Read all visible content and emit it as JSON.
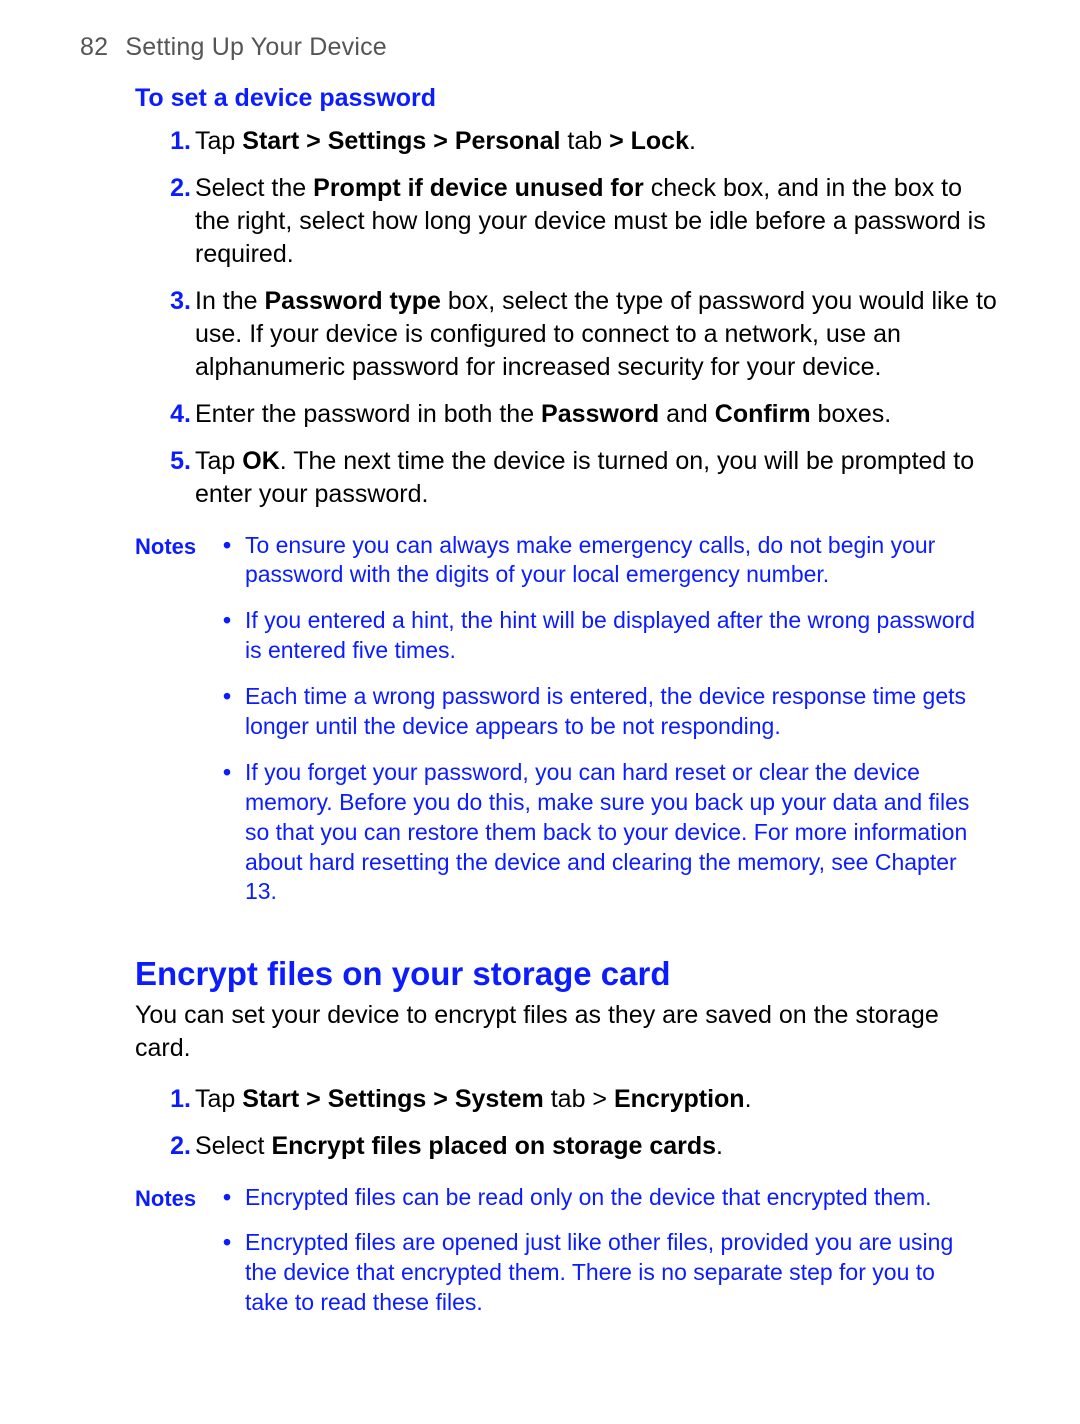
{
  "header": {
    "page_number": "82",
    "title": "Setting Up Your Device"
  },
  "section1": {
    "subheading": "To set a device password",
    "steps": [
      {
        "n": "1.",
        "pre": "Tap ",
        "b1": "Start > Settings > Personal",
        "mid": " tab ",
        "b2": "> Lock",
        "post": "."
      },
      {
        "n": "2.",
        "pre": "Select the ",
        "b1": "Prompt if device unused for",
        "mid": " check box, and in the box to the right, select how long your device must be idle before a password is required.",
        "b2": "",
        "post": ""
      },
      {
        "n": "3.",
        "pre": "In the ",
        "b1": "Password type",
        "mid": " box, select the type of password you would like to use. If your device is configured to connect to a network, use an alphanumeric password for increased security for your device.",
        "b2": "",
        "post": ""
      },
      {
        "n": "4.",
        "pre": "Enter the password in both the ",
        "b1": "Password",
        "mid": " and ",
        "b2": "Confirm",
        "post": " boxes."
      },
      {
        "n": "5.",
        "pre": "Tap ",
        "b1": "OK",
        "mid": ". The next time the device is turned on, you will be prompted to enter your password.",
        "b2": "",
        "post": ""
      }
    ],
    "notes_label": "Notes",
    "notes": [
      "To ensure you can always make emergency calls, do not begin your password with the digits of your local emergency number.",
      "If you entered a hint, the hint will be displayed after the wrong password is entered five times.",
      "Each time a wrong password is entered, the device response time gets longer until the device appears to be not responding.",
      "If you forget your password, you can hard reset or clear the device memory. Before you do this, make sure you back up your data and files so that you can restore them back to your device. For more information about hard resetting the device and clearing the memory, see Chapter 13."
    ]
  },
  "section2": {
    "heading": "Encrypt files on your storage card",
    "intro": "You can set your device to encrypt files as they are saved on the storage card.",
    "steps": [
      {
        "n": "1.",
        "pre": "Tap ",
        "b1": "Start > Settings > System",
        "mid": " tab > ",
        "b2": "Encryption",
        "post": "."
      },
      {
        "n": "2.",
        "pre": "Select ",
        "b1": "Encrypt files placed on storage cards",
        "mid": ".",
        "b2": "",
        "post": ""
      }
    ],
    "notes_label": "Notes",
    "notes": [
      "Encrypted files can be read only on the device that encrypted them.",
      "Encrypted files are opened just like other files, provided you are using the device that encrypted them. There is no separate step for you to take to read these files."
    ]
  }
}
